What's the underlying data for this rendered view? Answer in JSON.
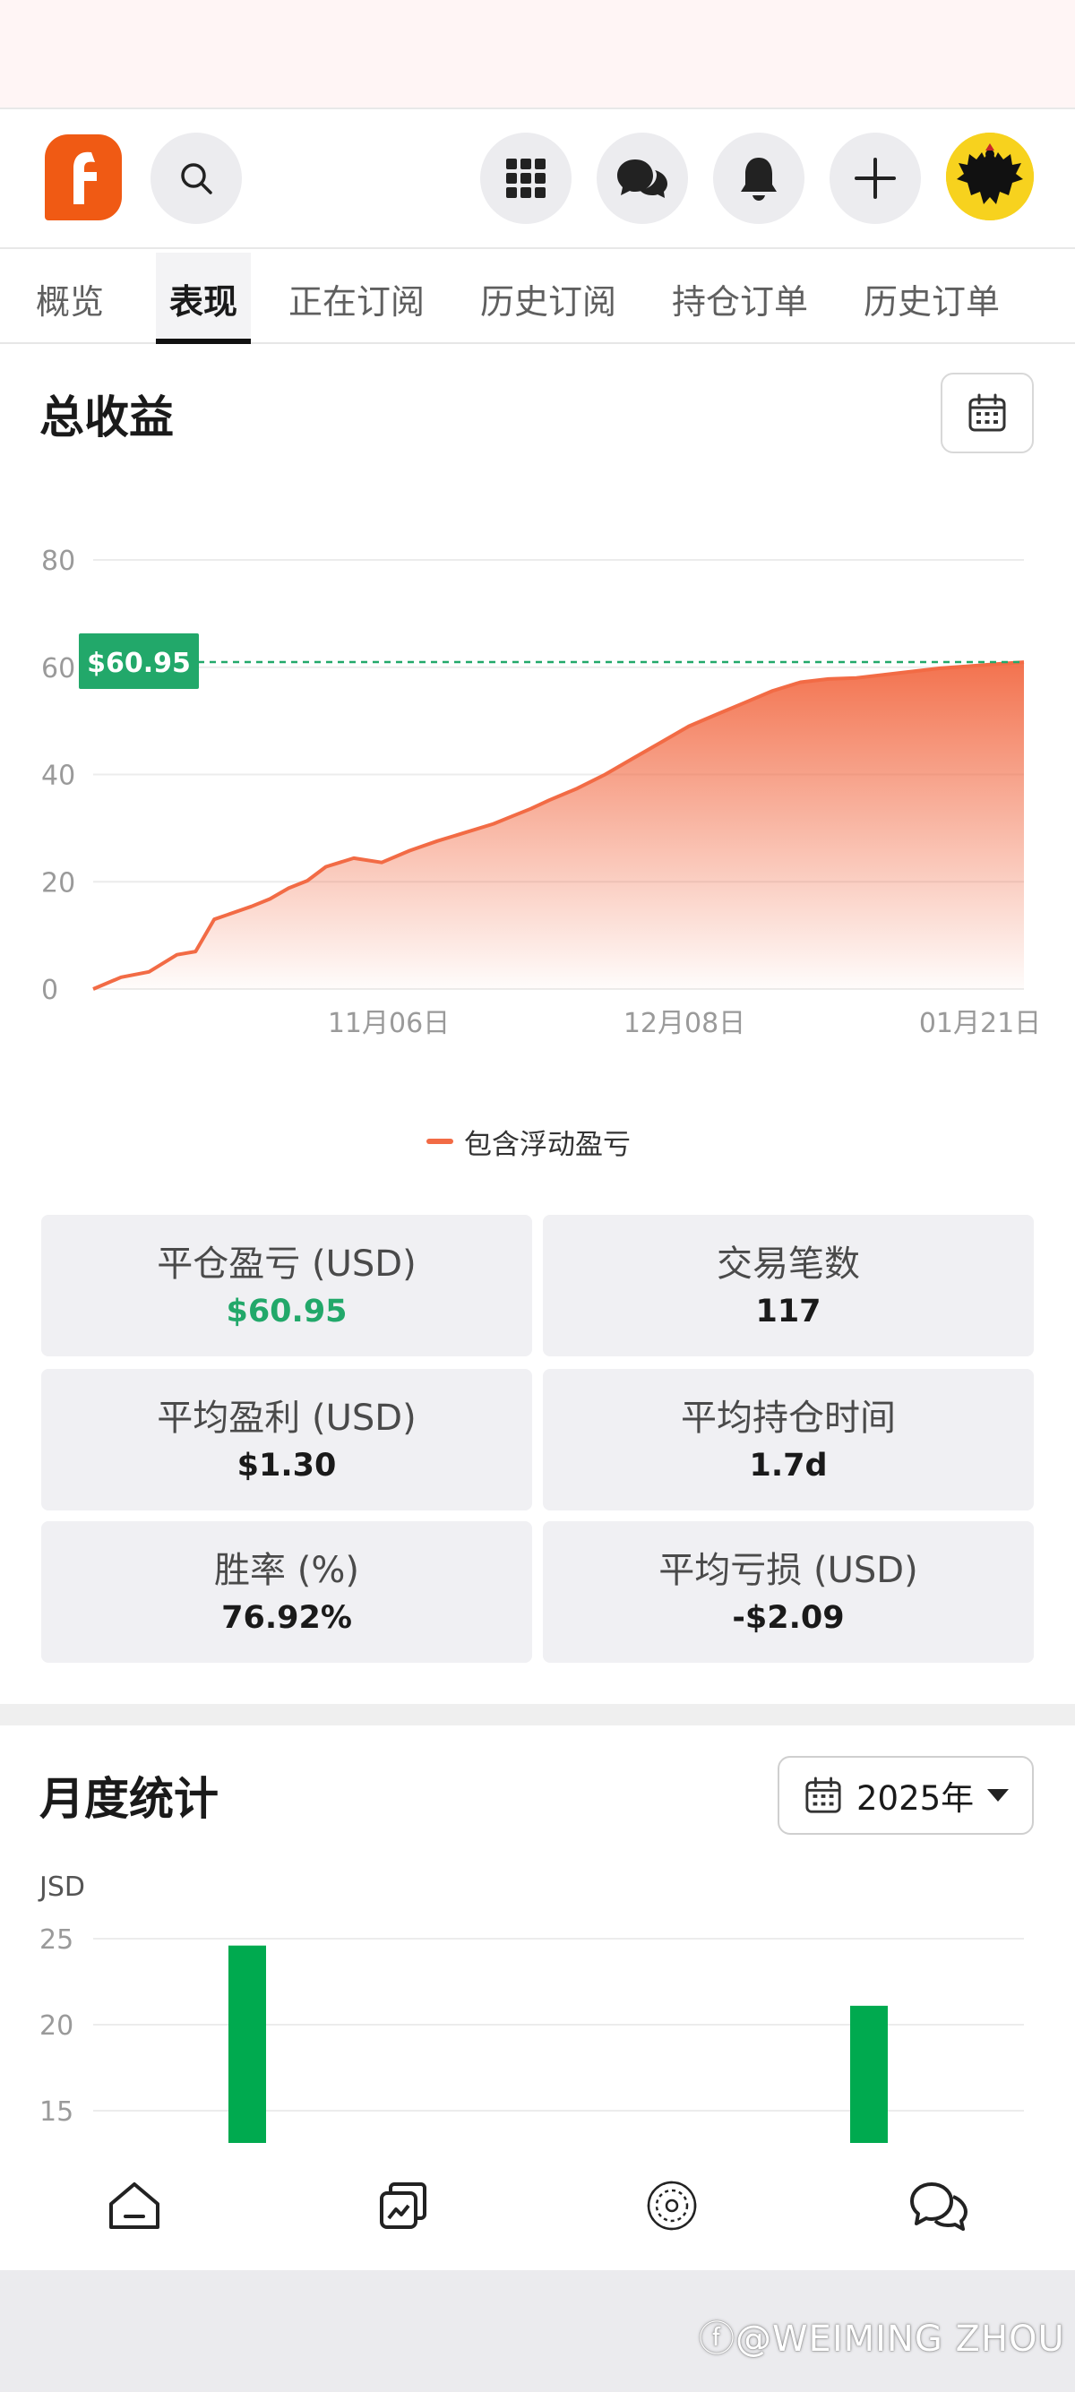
{
  "tabs": [
    {
      "label": "概览",
      "active": false
    },
    {
      "label": "表现",
      "active": true
    },
    {
      "label": "正在订阅",
      "active": false
    },
    {
      "label": "历史订阅",
      "active": false
    },
    {
      "label": "持仓订单",
      "active": false
    },
    {
      "label": "历史订单",
      "active": false
    }
  ],
  "total_profit": {
    "title": "总收益",
    "legend": "包含浮动盈亏",
    "current_tag": "$60.95"
  },
  "stats": [
    {
      "label": "平仓盈亏 (USD)",
      "value": "$60.95",
      "highlight": true
    },
    {
      "label": "交易笔数",
      "value": "117",
      "highlight": false
    },
    {
      "label": "平均盈利 (USD)",
      "value": "$1.30",
      "highlight": false
    },
    {
      "label": "平均持仓时间",
      "value": "1.7d",
      "highlight": false
    },
    {
      "label": "胜率 (%)",
      "value": "76.92%",
      "highlight": false
    },
    {
      "label": "平均亏损 (USD)",
      "value": "-$2.09",
      "highlight": false
    }
  ],
  "monthly": {
    "title": "月度统计",
    "year_label": "2025年"
  },
  "icons": {
    "logo": "app-logo-icon",
    "search": "search-icon",
    "apps": "grid-apps-icon",
    "chat": "chat-bubbles-icon",
    "bell": "bell-icon",
    "plus": "plus-icon",
    "avatar": "eagle-avatar-icon",
    "calendar": "calendar-icon",
    "home": "home-icon",
    "copy": "copy-trade-icon",
    "explore": "explore-icon",
    "messages": "messages-icon"
  },
  "colors": {
    "brand": "#f05a14",
    "line": "#f26b45",
    "positive": "#22a86a",
    "bar": "#00aa4f"
  },
  "chart_data": [
    {
      "type": "area",
      "title": "",
      "xlabel": "",
      "ylabel": "",
      "x_ticks": [
        "11月06日",
        "12月08日",
        "01月21日"
      ],
      "y_ticks": [
        0,
        20,
        40,
        60,
        80
      ],
      "ylim": [
        0,
        80
      ],
      "grid": true,
      "legend_position": "bottom-center",
      "series": [
        {
          "name": "包含浮动盈亏",
          "x": [
            0,
            3,
            6,
            9,
            11,
            13,
            17,
            19,
            21,
            23,
            25,
            28,
            31,
            34,
            37,
            40,
            43,
            45,
            47,
            49,
            52,
            55,
            58,
            61,
            64,
            67,
            70,
            73,
            76,
            79,
            82,
            85,
            88,
            91,
            94,
            97,
            100
          ],
          "values": [
            0,
            2.2,
            3.2,
            6.4,
            7.0,
            13.0,
            15.4,
            16.8,
            18.8,
            20.2,
            22.8,
            24.4,
            23.6,
            25.8,
            27.6,
            29.2,
            30.8,
            32.2,
            33.6,
            35.2,
            37.4,
            40.0,
            43.0,
            46.0,
            49.0,
            51.2,
            53.4,
            55.6,
            57.2,
            57.8,
            58.0,
            58.6,
            59.2,
            59.8,
            60.2,
            60.6,
            60.95
          ]
        }
      ],
      "current_value": 60.95
    },
    {
      "type": "bar",
      "title": "",
      "ylabel": "JSD",
      "y_ticks": [
        15,
        20,
        25
      ],
      "ylim": [
        15,
        25
      ],
      "grid": true,
      "series": [
        {
          "values": [
            24.6,
            21.1
          ]
        }
      ]
    }
  ]
}
